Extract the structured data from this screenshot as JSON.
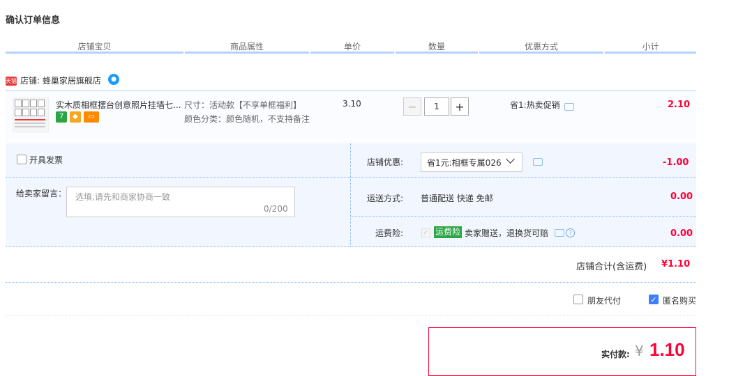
{
  "page_title": "确认订单信息",
  "columns": [
    "店铺宝贝",
    "商品属性",
    "单价",
    "数量",
    "优惠方式",
    "小计"
  ],
  "shop": {
    "badge": "天猫",
    "name": "店铺: 蜂巢家居旗舰店"
  },
  "item": {
    "name": "实木质相框摆台创意照片挂墙七...",
    "sku_size": "尺寸：活动款【不享单框福利】",
    "sku_color": "颜色分类：颜色随机，不支持备注",
    "unit_price": "3.10",
    "quantity": "1",
    "discount": "省1:热卖促销",
    "subtotal": "2.10"
  },
  "options": {
    "invoice_label": "开具发票",
    "message_label": "给卖家留言：",
    "message_placeholder": "选填,请先和商家协商一致",
    "message_count": "0/200",
    "shop_discount_label": "店铺优惠:",
    "shop_discount_value": "省1元:相框专属026",
    "shop_discount_amount": "-1.00",
    "shipping_label": "运送方式:",
    "shipping_value": "普通配送 快递 免邮",
    "shipping_amount": "0.00",
    "insurance_label": "运费险:",
    "insurance_tag": "运费险",
    "insurance_text": "卖家赠送，退换货可赔",
    "insurance_amount": "0.00"
  },
  "shop_total": {
    "label": "店铺合计(含运费)",
    "value": "¥1.10"
  },
  "pay_options": {
    "friend_pay": "朋友代付",
    "anonymous": "匿名购买"
  },
  "payment": {
    "label": "实付款:",
    "currency": "¥",
    "amount": "1.10"
  },
  "colors": {
    "accent_red": "#ff0036",
    "header_bar": "#b2d1ff",
    "panel_bg": "#f2f7ff"
  }
}
